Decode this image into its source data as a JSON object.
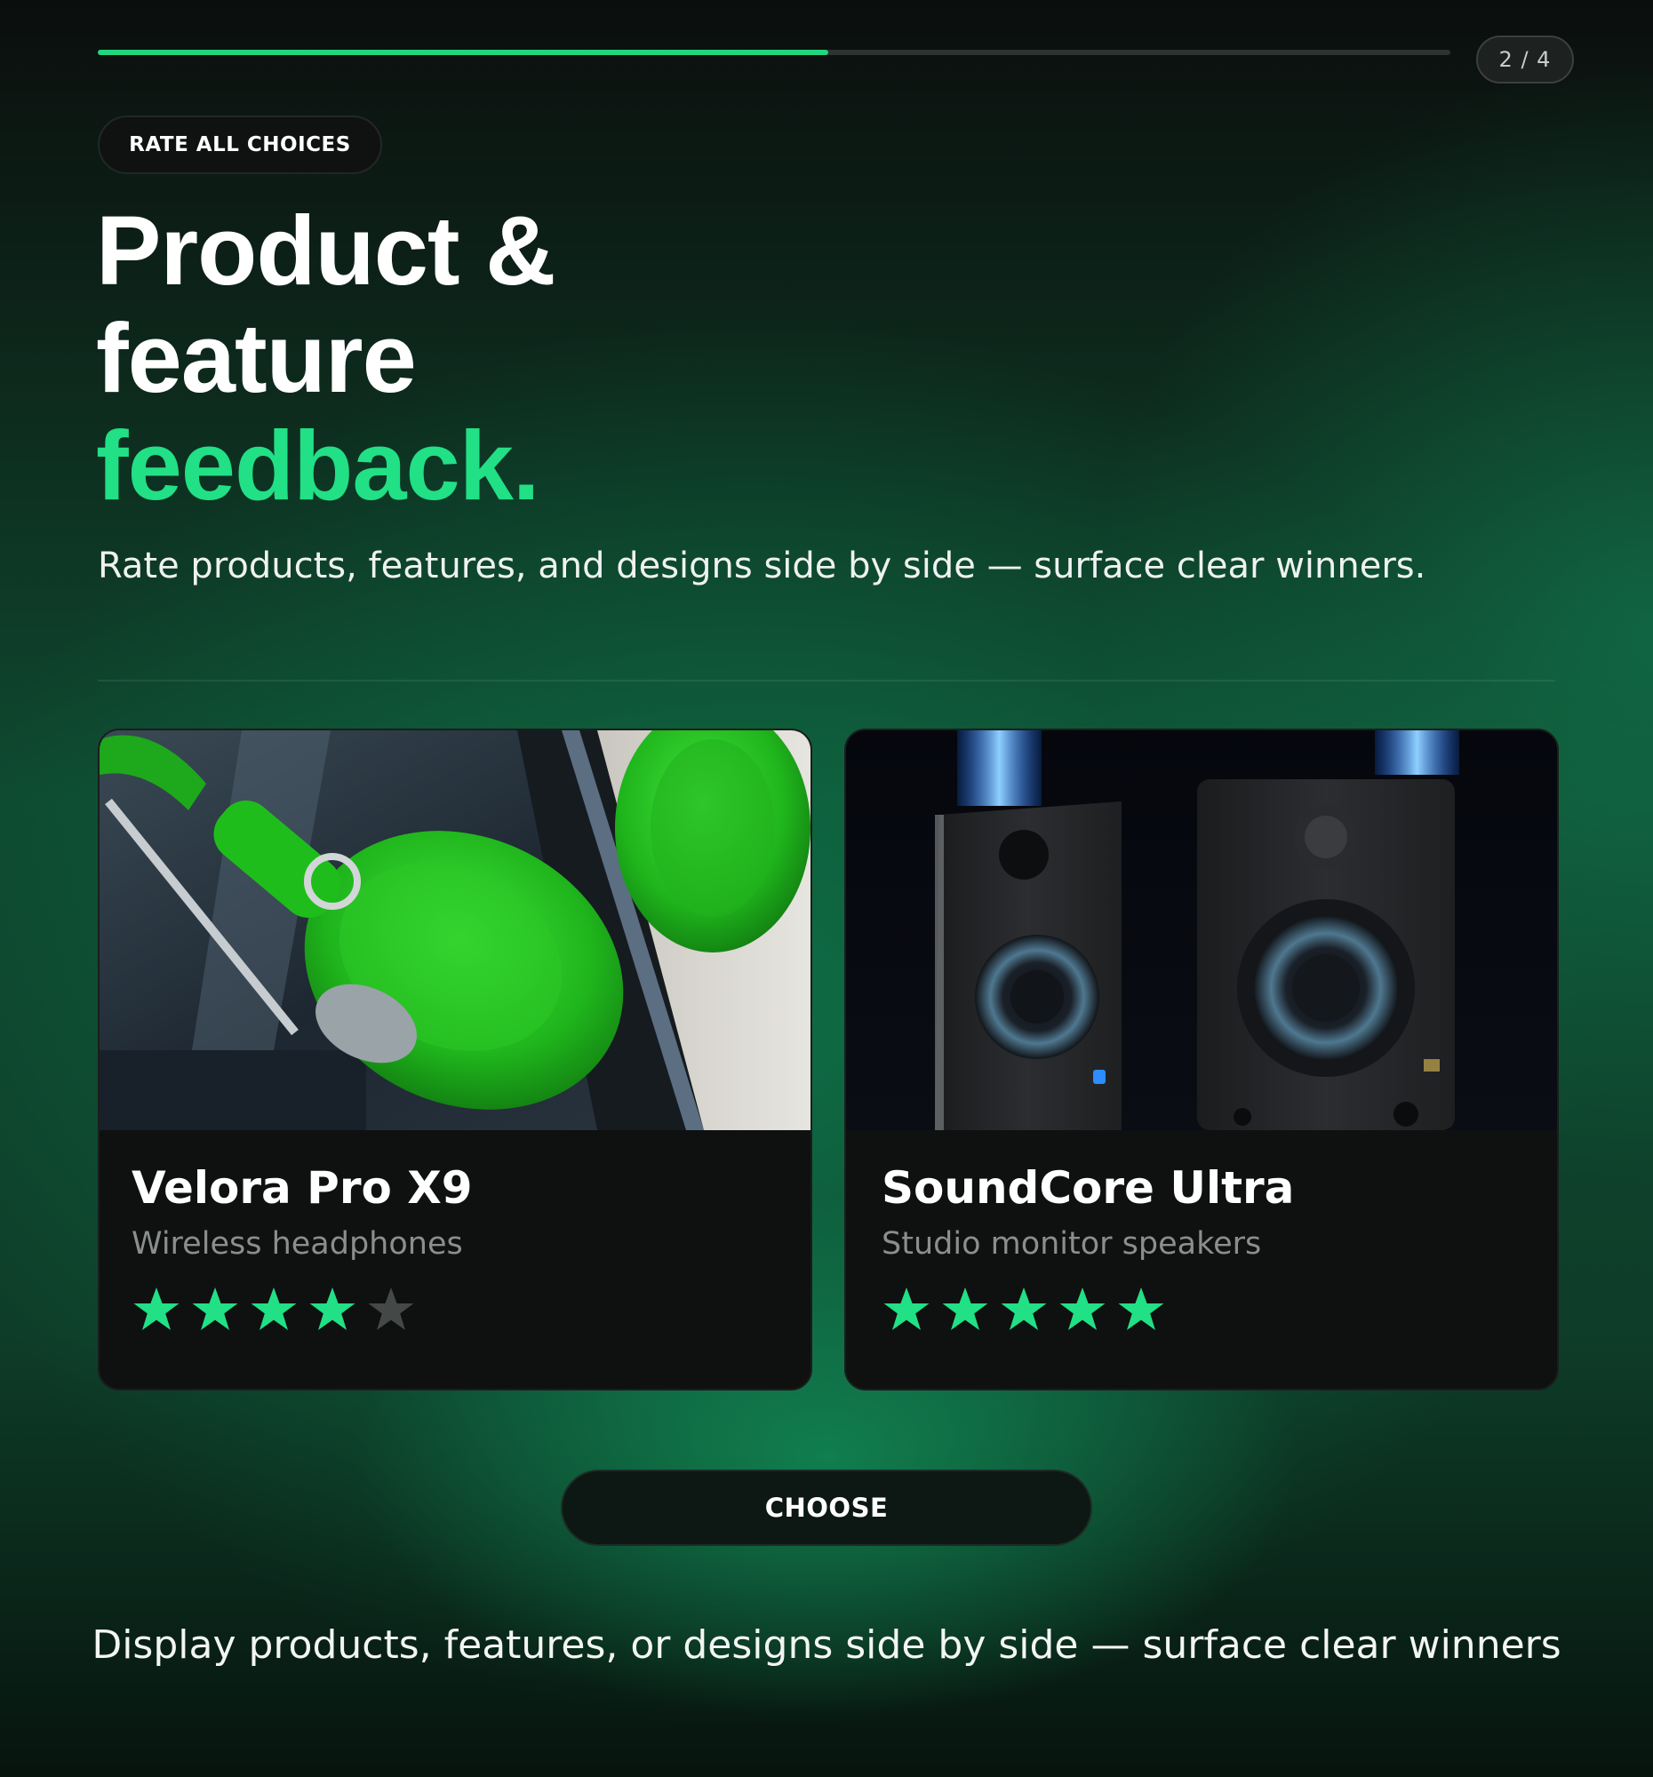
{
  "progress": {
    "fraction": 0.54,
    "step_label": "2 / 4"
  },
  "tag_label": "RATE ALL CHOICES",
  "headline": {
    "line1": "Product &",
    "line2": "feature",
    "line3": "feedback."
  },
  "subtitle": "Rate products, features, and designs side by side — surface clear winners.",
  "cards": [
    {
      "title": "Velora Pro X9",
      "subtitle": "Wireless headphones",
      "image_icon": "green-headphones-photo",
      "rating": 4,
      "max_rating": 5
    },
    {
      "title": "SoundCore Ultra",
      "subtitle": "Studio monitor speakers",
      "image_icon": "studio-speakers-photo",
      "rating": 5,
      "max_rating": 5
    }
  ],
  "choose_label": "CHOOSE",
  "footer_text": "Display products, features, or designs side by side — surface clear winners",
  "colors": {
    "accent": "#21e085",
    "star_filled": "#21e085",
    "star_empty": "#444846",
    "card_bg": "#0f1010"
  }
}
